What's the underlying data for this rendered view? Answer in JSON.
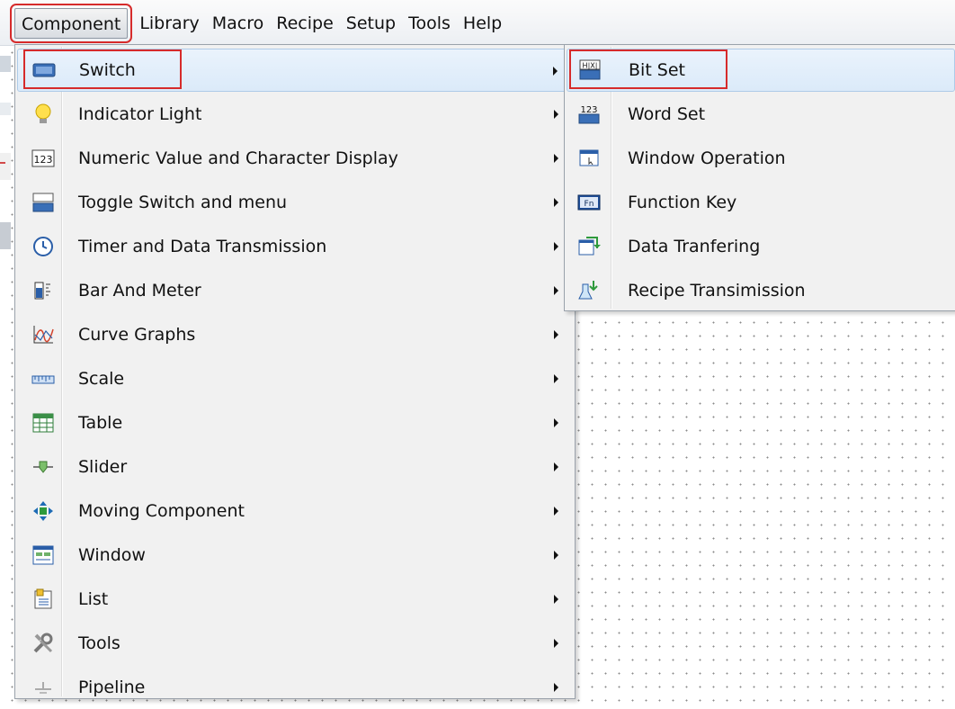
{
  "menubar": {
    "items": [
      "Component",
      "Library",
      "Macro",
      "Recipe",
      "Setup",
      "Tools",
      "Help"
    ],
    "active": "Component"
  },
  "component_menu": {
    "items": [
      {
        "label": "Switch",
        "icon": "switch-icon",
        "has_submenu": true,
        "highlighted": true
      },
      {
        "label": "Indicator Light",
        "icon": "bulb-icon",
        "has_submenu": true
      },
      {
        "label": "Numeric Value and Character Display",
        "icon": "numeric-123-icon",
        "has_submenu": true
      },
      {
        "label": "Toggle Switch and menu",
        "icon": "toggle-switch-icon",
        "has_submenu": true
      },
      {
        "label": "Timer and Data Transmission",
        "icon": "clock-icon",
        "has_submenu": true
      },
      {
        "label": "Bar And Meter",
        "icon": "bar-meter-icon",
        "has_submenu": true
      },
      {
        "label": "Curve Graphs",
        "icon": "curve-graph-icon",
        "has_submenu": true
      },
      {
        "label": "Scale",
        "icon": "scale-ruler-icon",
        "has_submenu": true
      },
      {
        "label": "Table",
        "icon": "table-grid-icon",
        "has_submenu": true
      },
      {
        "label": "Slider",
        "icon": "slider-icon",
        "has_submenu": true
      },
      {
        "label": "Moving Component",
        "icon": "move-arrows-icon",
        "has_submenu": true
      },
      {
        "label": "Window",
        "icon": "window-icon",
        "has_submenu": true
      },
      {
        "label": "List",
        "icon": "list-icon",
        "has_submenu": true
      },
      {
        "label": "Tools",
        "icon": "wrench-tools-icon",
        "has_submenu": true
      },
      {
        "label": "Pipeline",
        "icon": "pipeline-icon",
        "has_submenu": true
      }
    ]
  },
  "switch_submenu": {
    "items": [
      {
        "label": "Bit Set",
        "icon": "bit-set-icon",
        "highlighted": true
      },
      {
        "label": "Word Set",
        "icon": "word-set-123-icon"
      },
      {
        "label": "Window Operation",
        "icon": "window-operation-icon"
      },
      {
        "label": "Function Key",
        "icon": "function-key-icon"
      },
      {
        "label": "Data Tranfering",
        "icon": "data-transfer-icon"
      },
      {
        "label": "Recipe Transimission",
        "icon": "recipe-transmission-icon"
      }
    ]
  },
  "colors": {
    "highlight_border": "#d62b2b",
    "hover_fill": "#dbeaf9",
    "menu_background": "#f1f1f1"
  }
}
